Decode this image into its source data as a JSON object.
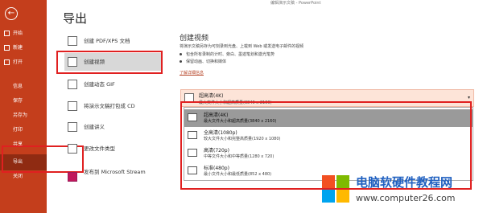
{
  "sidebar": {
    "back_icon": "arrow-left-icon",
    "items": [
      {
        "label": "开始"
      },
      {
        "label": "新建"
      },
      {
        "label": "打开"
      },
      {
        "label": "信息"
      },
      {
        "label": "保存"
      },
      {
        "label": "另存为"
      },
      {
        "label": "打印"
      },
      {
        "label": "共享"
      },
      {
        "label": "导出"
      },
      {
        "label": "关闭"
      }
    ]
  },
  "page_title": "导出",
  "top_right_info": "编辑演示文稿 - PowerPoint",
  "export_options": [
    {
      "label": "创建 PDF/XPS 文档",
      "icon": "pdf-icon"
    },
    {
      "label": "创建视频",
      "icon": "video-icon"
    },
    {
      "label": "创建动态 GIF",
      "icon": "gif-icon"
    },
    {
      "label": "将演示文稿打包成 CD",
      "icon": "cd-icon"
    },
    {
      "label": "创建讲义",
      "icon": "handout-icon"
    },
    {
      "label": "更改文件类型",
      "icon": "file-type-icon"
    },
    {
      "label": "发布到 Microsoft Stream",
      "icon": "stream-icon"
    }
  ],
  "right": {
    "title": "创建视频",
    "desc": "将演示文稿另存为可刻录到光盘、上载到 Web 或发送电子邮件的视频",
    "bullets": [
      "包含所有录制的计时、旁白、墨迹笔划和激光笔势",
      "保留动画、切换和媒体"
    ],
    "learn_more": "了解详细信息",
    "quality_select": {
      "name": "超高清(4K)",
      "desc": "最大文件大小和超高质量(3840 x 2160)"
    }
  },
  "dropdown_items": [
    {
      "name": "超高清(4K)",
      "desc": "最大文件大小和超高质量(3840 x 2160)"
    },
    {
      "name": "全高清(1080p)",
      "desc": "较大文件大小和完整高质量(1920 x 1080)"
    },
    {
      "name": "高清(720p)",
      "desc": "中等文件大小和中等质量(1280 x 720)"
    },
    {
      "name": "标准(480p)",
      "desc": "最小文件大小和最低质量(852 x 480)"
    }
  ],
  "watermark": {
    "line1": "电脑软硬件教程网",
    "line2": "www.computer26.com"
  },
  "colors": {
    "accent": "#c43e1c",
    "highlight": "#e02020"
  }
}
